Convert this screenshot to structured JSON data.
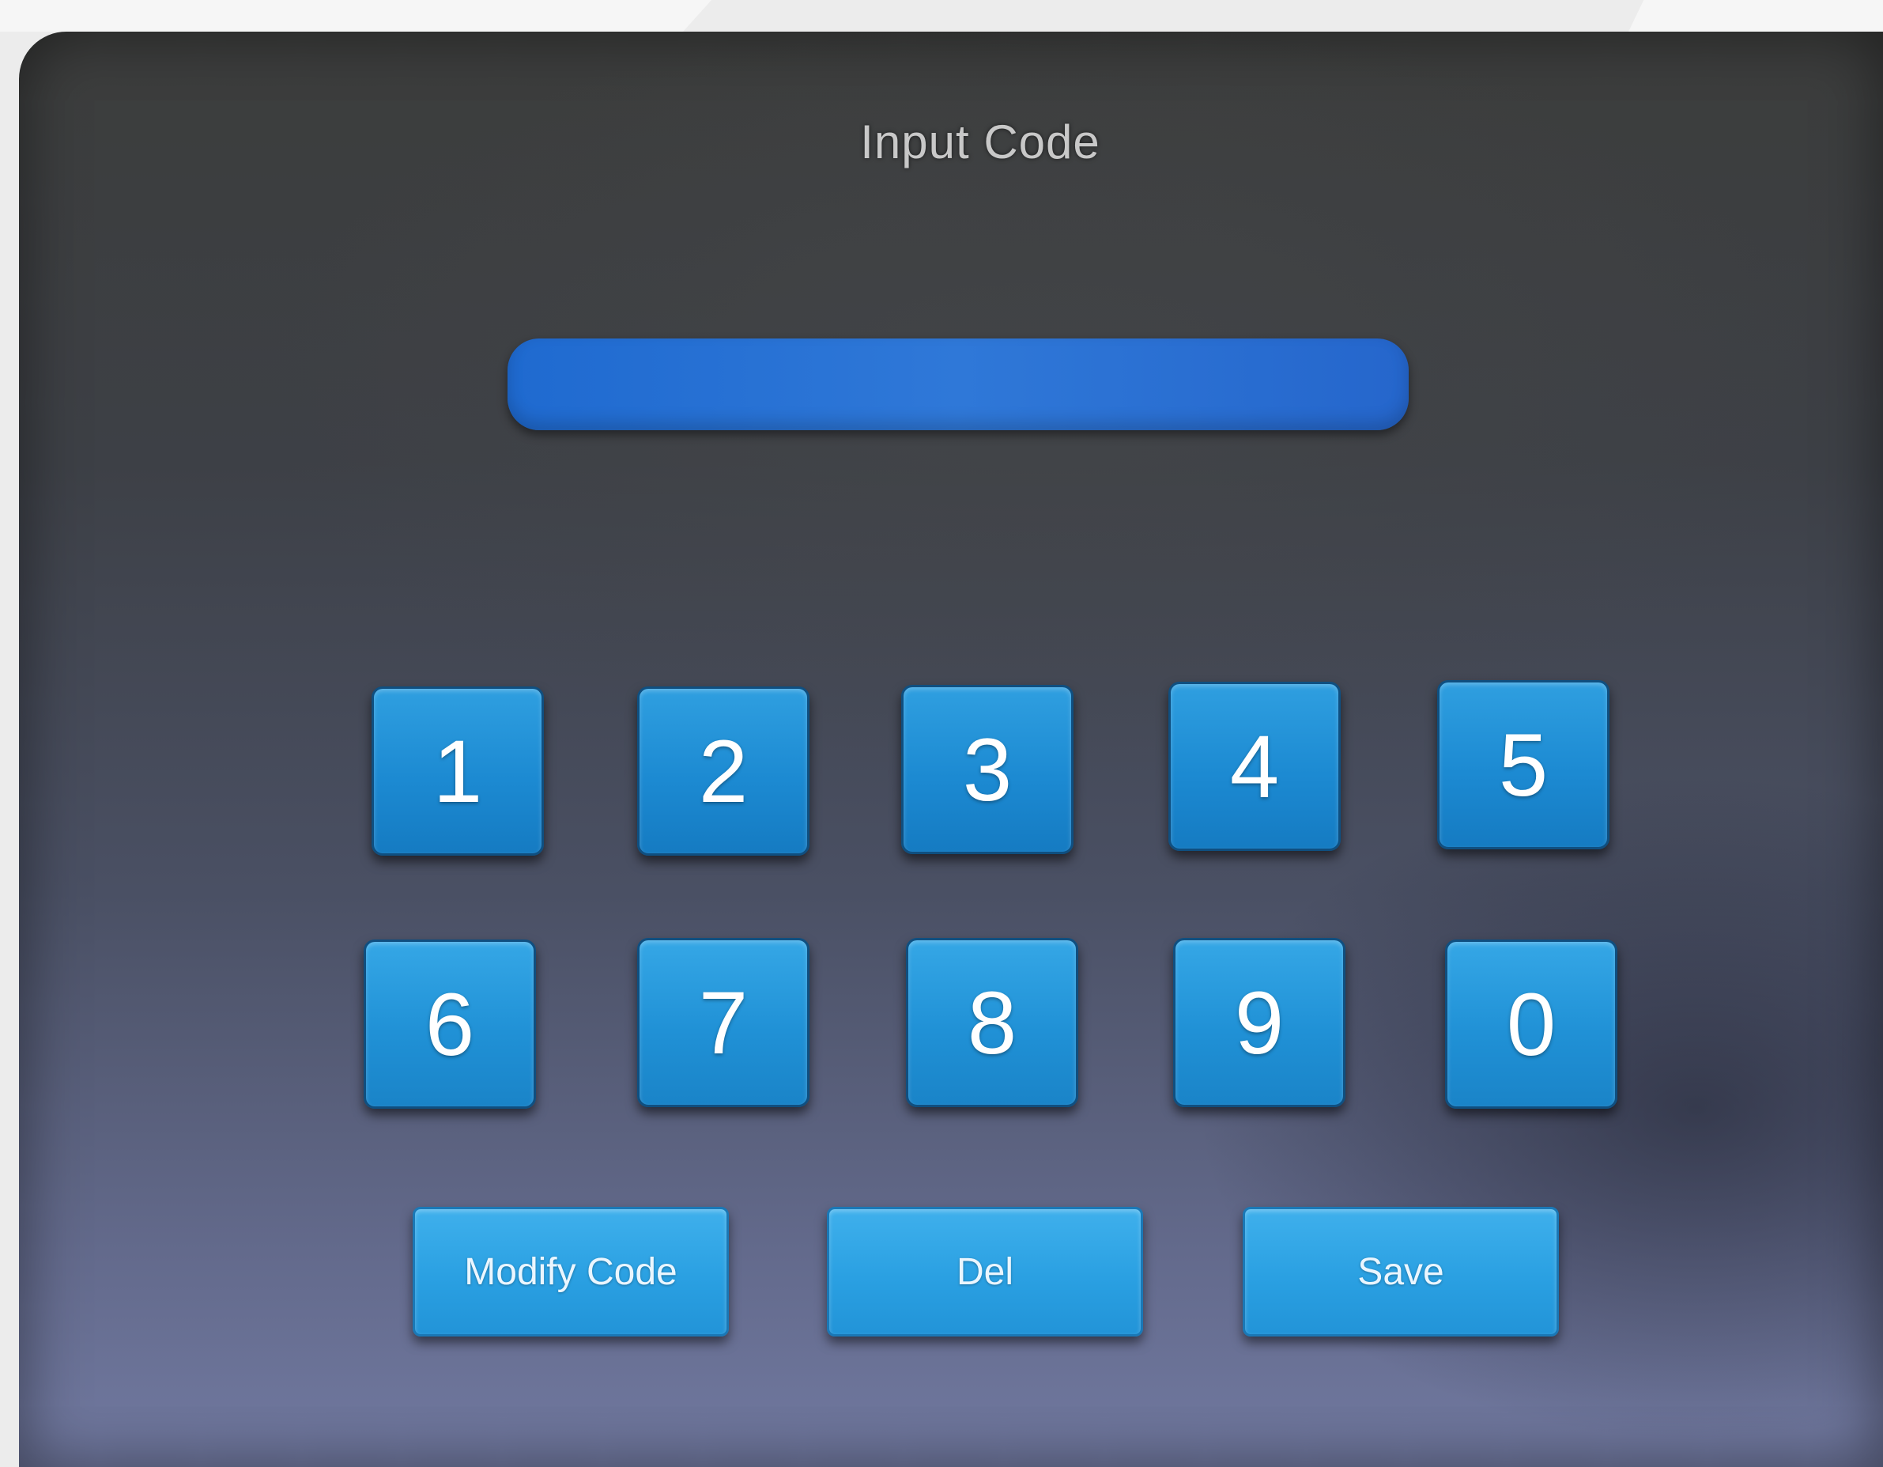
{
  "screen": {
    "title": "Input Code"
  },
  "code_input": {
    "value": "",
    "placeholder": ""
  },
  "keypad": {
    "row1": [
      "1",
      "2",
      "3",
      "4",
      "5"
    ],
    "row2": [
      "6",
      "7",
      "8",
      "9",
      "0"
    ]
  },
  "actions": {
    "modify_code": "Modify Code",
    "del": "Del",
    "save": "Save"
  },
  "colors": {
    "key_blue": "#1c8ad2",
    "input_blue": "#2f78d8",
    "action_blue": "#2aa0e2",
    "title_text": "#c8c8c8"
  }
}
